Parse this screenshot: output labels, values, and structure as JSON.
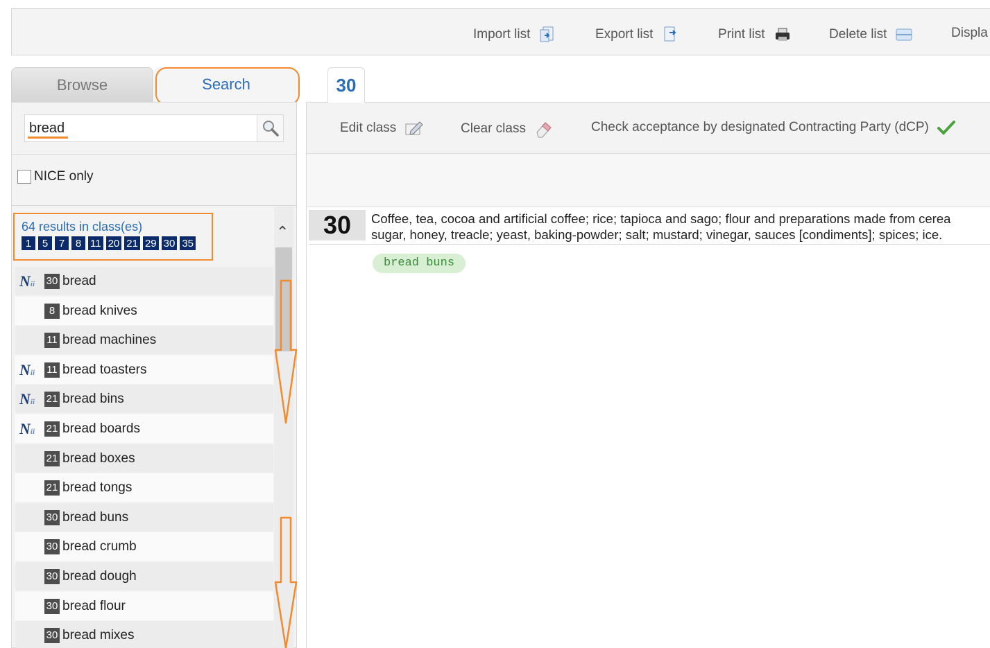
{
  "toolbar": {
    "import": "Import list",
    "export": "Export list",
    "print": "Print list",
    "delete": "Delete list",
    "display": "Displa"
  },
  "tabs": {
    "browse": "Browse",
    "search": "Search"
  },
  "search": {
    "value": "bread"
  },
  "nice_only_label": "NICE only",
  "results": {
    "summary": "64 results in class(es)",
    "classes": [
      "1",
      "5",
      "7",
      "8",
      "11",
      "20",
      "21",
      "29",
      "30",
      "35"
    ],
    "items": [
      {
        "nice": true,
        "class": "30",
        "label": "bread"
      },
      {
        "nice": false,
        "class": "8",
        "label": "bread knives"
      },
      {
        "nice": false,
        "class": "11",
        "label": "bread machines"
      },
      {
        "nice": true,
        "class": "11",
        "label": "bread toasters"
      },
      {
        "nice": true,
        "class": "21",
        "label": "bread bins"
      },
      {
        "nice": true,
        "class": "21",
        "label": "bread boards"
      },
      {
        "nice": false,
        "class": "21",
        "label": "bread boxes"
      },
      {
        "nice": false,
        "class": "21",
        "label": "bread tongs"
      },
      {
        "nice": false,
        "class": "30",
        "label": "bread buns"
      },
      {
        "nice": false,
        "class": "30",
        "label": "bread crumb"
      },
      {
        "nice": false,
        "class": "30",
        "label": "bread dough"
      },
      {
        "nice": false,
        "class": "30",
        "label": "bread flour"
      },
      {
        "nice": false,
        "class": "30",
        "label": "bread mixes"
      }
    ],
    "nice_mark": "N",
    "nice_mark_sub": "ii"
  },
  "right": {
    "tab_label": "30",
    "edit_class": "Edit class",
    "clear_class": "Clear class",
    "check_acceptance": "Check acceptance by designated Contracting Party (dCP)",
    "class_number": "30",
    "class_desc_line1": "Coffee, tea, cocoa and artificial coffee; rice; tapioca and sago; flour and preparations made from cerea",
    "class_desc_line2": "sugar, honey, treacle; yeast, baking-powder; salt; mustard; vinegar, sauces [condiments]; spices; ice.",
    "selected_term": "bread buns"
  },
  "colors": {
    "accent_orange": "#f28a2e",
    "link_blue": "#2a6db5",
    "chip_navy": "#0b2a6b",
    "pill_green": "#d8efd4"
  }
}
